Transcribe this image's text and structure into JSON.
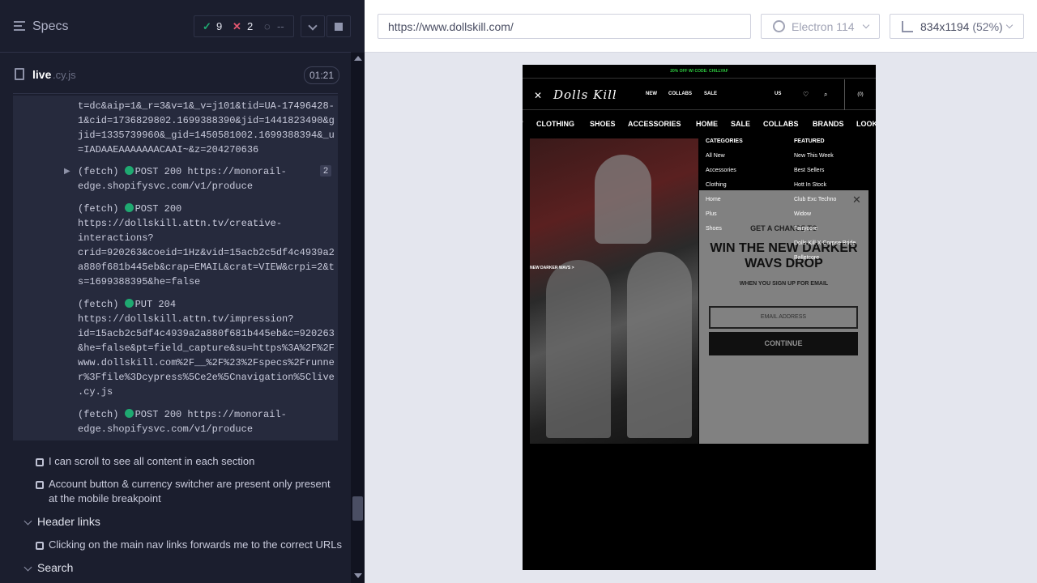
{
  "reporter": {
    "title": "Specs",
    "stats": {
      "passed": "9",
      "failed": "2",
      "pending": "--"
    },
    "file": {
      "name": "live",
      "ext": ".cy.js",
      "duration": "01:21"
    },
    "log": {
      "block1": "t=dc&aip=1&_r=3&v=1&_v=j101&tid=UA-17496428-\n1&cid=1736829802.1699388390&jid=1441823490&g\njid=1335739960&_gid=1450581002.1699388394&_u\n=IADAAEAAAAAAACAAI~&z=204270636",
      "entry2_prefix": "(fetch) ",
      "entry2_rest": "POST 200 https://monorail-\nedge.shopifysvc.com/v1/produce",
      "entry2_count": "2",
      "entry3_prefix": "(fetch) ",
      "entry3_rest": "POST 200\nhttps://dollskill.attn.tv/creative-\ninteractions?\ncrid=920263&coeid=1Hz&vid=15acb2c5df4c4939a2\na880f681b445eb&crap=EMAIL&crat=VIEW&crpi=2&t\ns=1699388395&he=false",
      "entry4_prefix": "(fetch) ",
      "entry4_rest": "PUT 204\nhttps://dollskill.attn.tv/impression?\nid=15acb2c5df4c4939a2a880f681b445eb&c=920263\n&he=false&pt=field_capture&su=https%3A%2F%2F\nwww.dollskill.com%2F__%2F%23%2Fspecs%2Frunne\nr%3Ffile%3Dcypress%5Ce2e%5Cnavigation%5Clive\n.cy.js",
      "entry5_prefix": "(fetch) ",
      "entry5_rest": "POST 200 https://monorail-\nedge.shopifysvc.com/v1/produce"
    },
    "tests": [
      "I can scroll to see all content in each section",
      "Account button & currency switcher are present only present at the mobile breakpoint"
    ],
    "suite_header_links": "Header links",
    "test_nav": "Clicking on the main nav links forwards me to the correct URLs",
    "suite_search": "Search"
  },
  "runner": {
    "url": "https://www.dollskill.com/",
    "browser": "Electron 114",
    "viewport": "834x1194",
    "scale": "(52%)"
  },
  "site": {
    "promo": "20% OFF W/ CODE: CHILLYAF",
    "logo": "Dolls Kill",
    "head_nav": [
      "NEW",
      "COLLABS",
      "SALE"
    ],
    "currency": "US",
    "bag": "(0)",
    "cat_nav": [
      "/",
      "CLOTHING",
      "SHOES",
      "ACCESSORIES",
      "HOME",
      "SALE",
      "COLLABS",
      "BRANDS",
      "LOOK"
    ],
    "hero_link": "NEW DARKER WAVS >",
    "menu_categories_title": "CATEGORIES",
    "menu_categories": [
      "All New",
      "Accessories",
      "Clothing",
      "Home",
      "Plus",
      "Shoes"
    ],
    "menu_featured_title": "FEATURED",
    "menu_featured": [
      "New This Week",
      "Best Sellers",
      "Hott In Stock",
      "Club Exc Techno",
      "Widow",
      "Fairycore",
      "Dolls Kill X Corpse Bride",
      "Balletcore"
    ],
    "modal": {
      "kicker": "GET A CHANCE TO",
      "headline": "WIN THE NEW DARKER WAVS DROP",
      "sub": "WHEN YOU SIGN UP FOR EMAIL",
      "email_placeholder": "EMAIL ADDRESS",
      "cta": "CONTINUE"
    }
  }
}
